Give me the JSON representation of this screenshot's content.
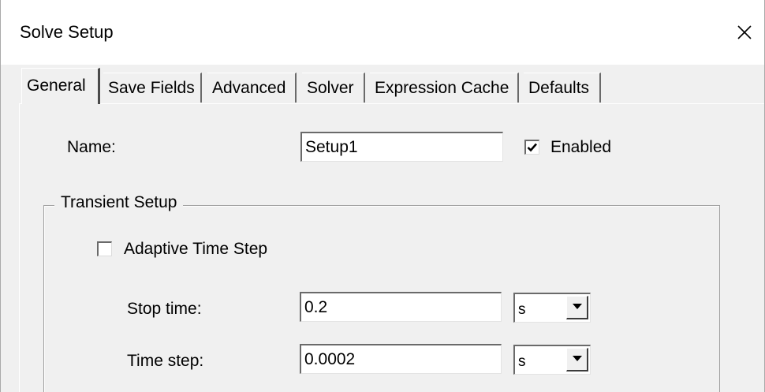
{
  "window": {
    "title": "Solve Setup"
  },
  "icons": {
    "close": "close-icon",
    "check": "check-icon",
    "dropdown": "chevron-down-icon"
  },
  "tabs": [
    {
      "label": "General",
      "active": true
    },
    {
      "label": "Save Fields",
      "active": false
    },
    {
      "label": "Advanced",
      "active": false
    },
    {
      "label": "Solver",
      "active": false
    },
    {
      "label": "Expression Cache",
      "active": false
    },
    {
      "label": "Defaults",
      "active": false
    }
  ],
  "general": {
    "name_label": "Name:",
    "name_value": "Setup1",
    "enabled_label": "Enabled",
    "enabled_checked": true
  },
  "transient": {
    "group_label": "Transient Setup",
    "adaptive_label": "Adaptive Time Step",
    "adaptive_checked": false,
    "stop_time_label": "Stop time:",
    "stop_time_value": "0.2",
    "stop_time_unit": "s",
    "time_step_label": "Time step:",
    "time_step_value": "0.0002",
    "time_step_unit": "s"
  }
}
